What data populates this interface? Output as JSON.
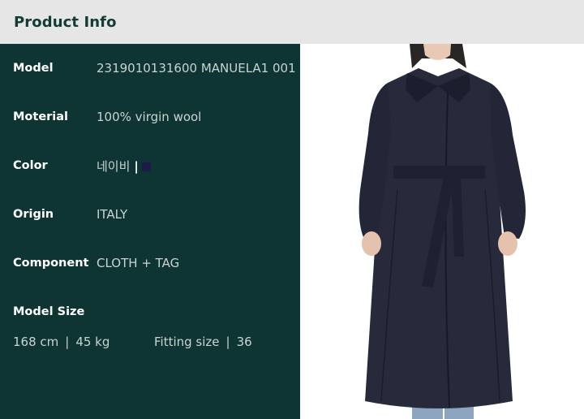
{
  "header": {
    "title": "Product Info"
  },
  "details": {
    "model": {
      "label": "Model",
      "value": "2319010131600 MANUELA1 001"
    },
    "material": {
      "label": "Moterial",
      "value": "100% virgin wool"
    },
    "color": {
      "label": "Color",
      "value": "네이비",
      "separator": "|",
      "swatch_color": "#1c1b45"
    },
    "origin": {
      "label": "Origin",
      "value": "ITALY"
    },
    "component": {
      "label": "Component",
      "value": "CLOTH + TAG"
    }
  },
  "model_size": {
    "label": "Model Size",
    "height": "168 cm",
    "weight": "45 kg",
    "separator": "|",
    "fitting_label": "Fitting size",
    "fitting_value": "36"
  },
  "colors": {
    "panel_bg": "#0e3534",
    "header_bg": "#e6e6e6",
    "header_text": "#123c36",
    "coat": "#262a3b"
  },
  "photo": {
    "icon": "model-wearing-navy-wrap-coat"
  }
}
